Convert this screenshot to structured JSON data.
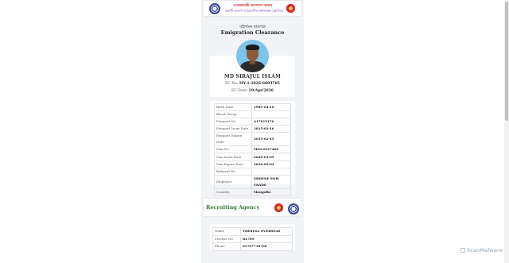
{
  "header": {
    "line1": "গণপ্রজাতন্ত্রী বাংলাদেশ সরকার",
    "line2": "প্রবাসী কল্যাণ ও বৈদেশিক কর্মসংস্থান মন্ত্রণালয়"
  },
  "title": {
    "bn": "বহির্গমন ছাড়পত্র",
    "en": "Emigration Clearance"
  },
  "profile": {
    "name": "MD SIRAJUL ISLAM",
    "ec_no_label": "EC No:",
    "ec_no_value": "MY-1-2026-6003705",
    "ec_date_label": "EC Date:",
    "ec_date_value": "29/Apr/2026"
  },
  "details": [
    {
      "label": "Birth Date",
      "value": "1985-04-10"
    },
    {
      "label": "Blood Group",
      "value": ""
    },
    {
      "label": "Passport No",
      "value": "A17915170"
    },
    {
      "label": "Passport Issue Date",
      "value": "2025-02-16"
    },
    {
      "label": "Passport Expire Date",
      "value": "2035-02-15"
    },
    {
      "label": "Visa No",
      "value": "MNG2527466"
    },
    {
      "label": "Visa Issue Date",
      "value": "2026-03-05"
    },
    {
      "label": "Visa Expire Date",
      "value": "2026-09-04"
    },
    {
      "label": "Referral No",
      "value": ""
    },
    {
      "label": "Employer",
      "value": "ERDENE ENH TRADE"
    },
    {
      "label": "Country",
      "value": "Mongolia"
    }
  ],
  "agency": {
    "title": "Recruiting Agency",
    "rows": [
      {
        "label": "Name",
        "value": "TRIMINA OVERSEAS"
      },
      {
        "label": "License No",
        "value": "RL789"
      },
      {
        "label": "Phone",
        "value": "01707718706"
      }
    ]
  },
  "watermark": "ScanMalware",
  "colors": {
    "agency_title": "#2e7d32",
    "header_line1": "#c62828",
    "header_line2": "#6a1b9a",
    "avatar_bg": "#7ec3ea"
  }
}
